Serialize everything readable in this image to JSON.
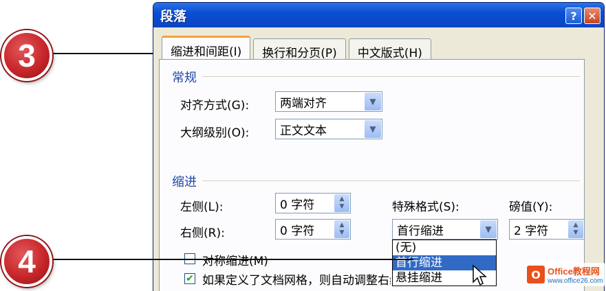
{
  "callouts": [
    {
      "number": "3"
    },
    {
      "number": "4"
    }
  ],
  "dialog": {
    "title": "段落",
    "help_glyph": "?",
    "close_glyph": "✕"
  },
  "tabs": [
    {
      "label": "缩进和间距(I)",
      "active": true
    },
    {
      "label": "换行和分页(P)",
      "active": false
    },
    {
      "label": "中文版式(H)",
      "active": false
    }
  ],
  "general": {
    "section_title": "常规",
    "alignment": {
      "label": "对齐方式(G):",
      "value": "两端对齐"
    },
    "outline_level": {
      "label": "大纲级别(O):",
      "value": "正文文本"
    }
  },
  "indent": {
    "section_title": "缩进",
    "left": {
      "label": "左侧(L):",
      "value": "0 字符"
    },
    "right": {
      "label": "右侧(R):",
      "value": "0 字符"
    },
    "special": {
      "label": "特殊格式(S):",
      "value": "首行缩进"
    },
    "by": {
      "label": "磅值(Y):",
      "value": "2 字符"
    },
    "special_options": [
      "(无)",
      "首行缩进",
      "悬挂缩进"
    ],
    "highlighted_option": "首行缩进",
    "mirror": {
      "label": "对称缩进(M)",
      "checked": false
    },
    "auto_grid": {
      "label": "如果定义了文档网格，则自动调整右缩进(D)",
      "checked": true
    }
  },
  "watermark": {
    "mark": "O",
    "name": "Office教程网",
    "url": "www.office26.com"
  },
  "colors": {
    "title_blue": "#0a4fd4",
    "section_blue": "#1f46a8",
    "highlight": "#316ac5",
    "callout_red": "#c8262a",
    "tab_accent": "#f7a03c"
  }
}
